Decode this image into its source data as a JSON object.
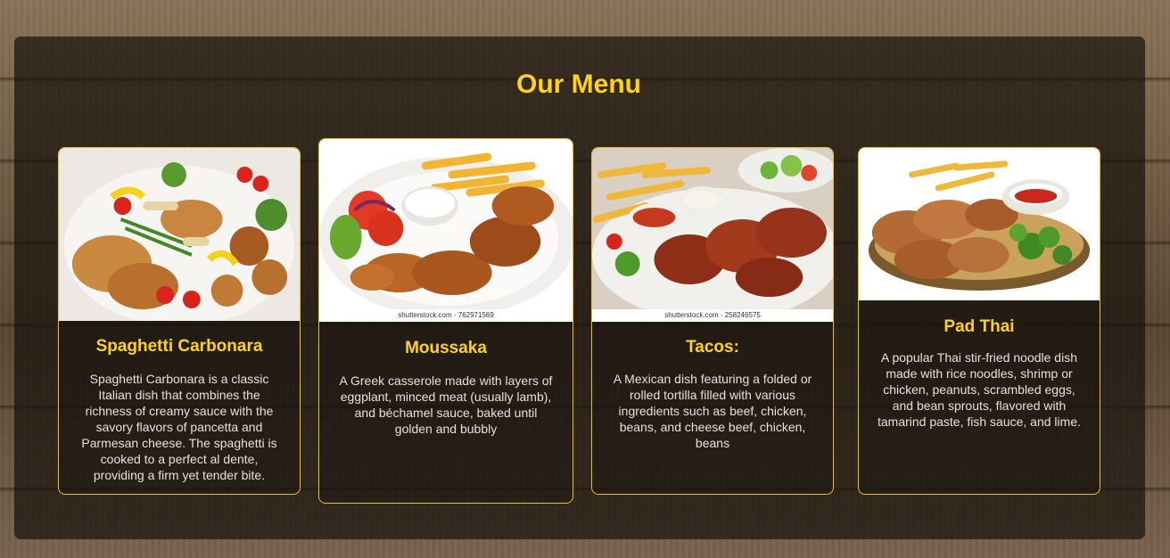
{
  "menu": {
    "title": "Our Menu",
    "items": [
      {
        "name": "Spaghetti Carbonara",
        "description": "Spaghetti Carbonara is a classic Italian dish that combines the richness of creamy sauce with the savory flavors of pancetta and Parmesan cheese. The spaghetti is cooked to a perfect al dente, providing a firm yet tender bite."
      },
      {
        "name": "Moussaka",
        "description": "A Greek casserole made with layers of eggplant, minced meat (usually lamb), and béchamel sauce, baked until golden and bubbly",
        "watermark": "shutterstock.com · 762971569"
      },
      {
        "name": "Tacos:",
        "description": "A Mexican dish featuring a folded or rolled tortilla filled with various ingredients such as beef, chicken, beans, and cheese beef, chicken, beans",
        "watermark": "shutterstock.com · 258246575"
      },
      {
        "name": "Pad Thai",
        "description": "A popular Thai stir-fried noodle dish made with rice noodles, shrimp or chicken, peanuts, scrambled eggs, and bean sprouts, flavored with tamarind paste, fish sauce, and lime."
      }
    ]
  },
  "colors": {
    "accent": "#ffd21a",
    "panel": "rgba(25,20,14,0.72)",
    "text": "#e6e1d8"
  }
}
